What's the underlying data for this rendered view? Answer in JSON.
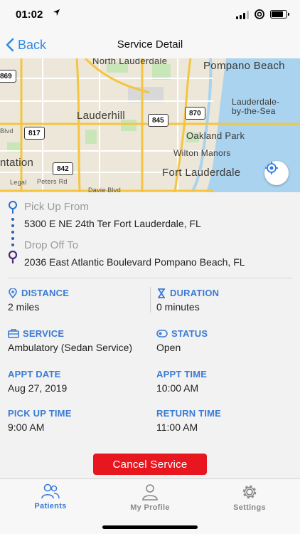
{
  "status_bar": {
    "time": "01:02",
    "battery_level": 0.85
  },
  "nav": {
    "back_label": "Back",
    "title": "Service Detail"
  },
  "map": {
    "labels": {
      "pompano_beach": "Pompano Beach",
      "north_lauderdale": "North Lauderdale",
      "lauderhill": "Lauderhill",
      "lauderdale_by_the_sea_1": "Lauderdale-",
      "lauderdale_by_the_sea_2": "by-the-Sea",
      "oakland_park": "Oakland Park",
      "wilton_manors": "Wilton Manors",
      "fort_lauderdale": "Fort Lauderdale",
      "plantation": "ntation",
      "davie_blvd": "Davie Blvd",
      "legal": "Legal",
      "peters_rd": "Peters Rd",
      "blvd": "Blvd"
    },
    "shields": {
      "s869": "869",
      "s845": "845",
      "s870": "870",
      "s817": "817",
      "s842": "842"
    },
    "locate_icon": "locate-target-icon"
  },
  "route": {
    "pickup_label": "Pick Up From",
    "pickup_address": "5300 E NE 24th Ter Fort Lauderdale, FL",
    "dropoff_label": "Drop Off To",
    "dropoff_address": "2036 East Atlantic Boulevard Pompano Beach, FL"
  },
  "details": {
    "distance_label": "DISTANCE",
    "distance_value": "2 miles",
    "duration_label": "DURATION",
    "duration_value": "0 minutes",
    "service_label": "SERVICE",
    "service_value": "Ambulatory (Sedan Service)",
    "status_label": "STATUS",
    "status_value": "Open",
    "appt_date_label": "APPT DATE",
    "appt_date_value": "Aug 27, 2019",
    "appt_time_label": "APPT TIME",
    "appt_time_value": "10:00 AM",
    "pickup_time_label": "PICK UP TIME",
    "pickup_time_value": "9:00 AM",
    "return_time_label": "RETURN TIME",
    "return_time_value": "11:00 AM"
  },
  "actions": {
    "cancel_label": "Cancel Service"
  },
  "tabs": [
    {
      "label": "Patients",
      "icon": "patients-icon",
      "active": true
    },
    {
      "label": "My Profile",
      "icon": "profile-icon",
      "active": false
    },
    {
      "label": "Settings",
      "icon": "settings-gear-icon",
      "active": false
    }
  ],
  "colors": {
    "accent": "#3a7bd5",
    "back_link": "#2f8ae5",
    "cancel_button": "#e8161e",
    "pin_dark": "#4a2a7a",
    "water": "#a9d3ee",
    "park": "#c9e6b8",
    "road_major": "#f4c542"
  }
}
